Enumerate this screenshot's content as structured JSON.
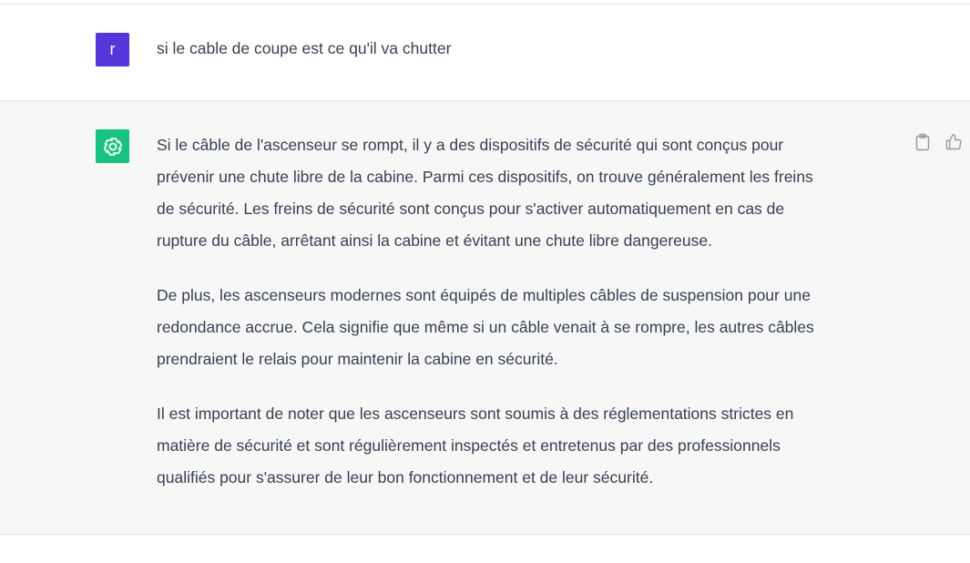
{
  "user_message": {
    "avatar_letter": "r",
    "avatar_color": "#5436da",
    "text": "si le cable de coupe est ce qu'il va chutter"
  },
  "assistant_message": {
    "avatar_icon": "openai-logo-icon",
    "avatar_color": "#19c37d",
    "paragraphs": [
      [
        "Si le câble de l'ascenseur se rompt, il y a des dispositifs de sécurité qui sont conçus pour",
        "prévenir une chute libre de la cabine. Parmi ces dispositifs, on trouve généralement les freins",
        "de sécurité. Les freins de sécurité sont conçus pour s'activer automatiquement en cas de",
        "rupture du câble, arrêtant ainsi la cabine et évitant une chute libre dangereuse."
      ],
      [
        "De plus, les ascenseurs modernes sont équipés de multiples câbles de suspension pour une",
        "redondance accrue. Cela signifie que même si un câble venait à se rompre, les autres câbles",
        "prendraient le relais pour maintenir la cabine en sécurité."
      ],
      [
        "Il est important de noter que les ascenseurs sont soumis à des réglementations strictes en",
        "matière de sécurité et sont régulièrement inspectés et entretenus par des professionnels",
        "qualifiés pour s'assurer de leur bon fonctionnement et de leur sécurité."
      ]
    ],
    "actions": [
      "clipboard-icon",
      "thumbs-up-icon"
    ]
  }
}
